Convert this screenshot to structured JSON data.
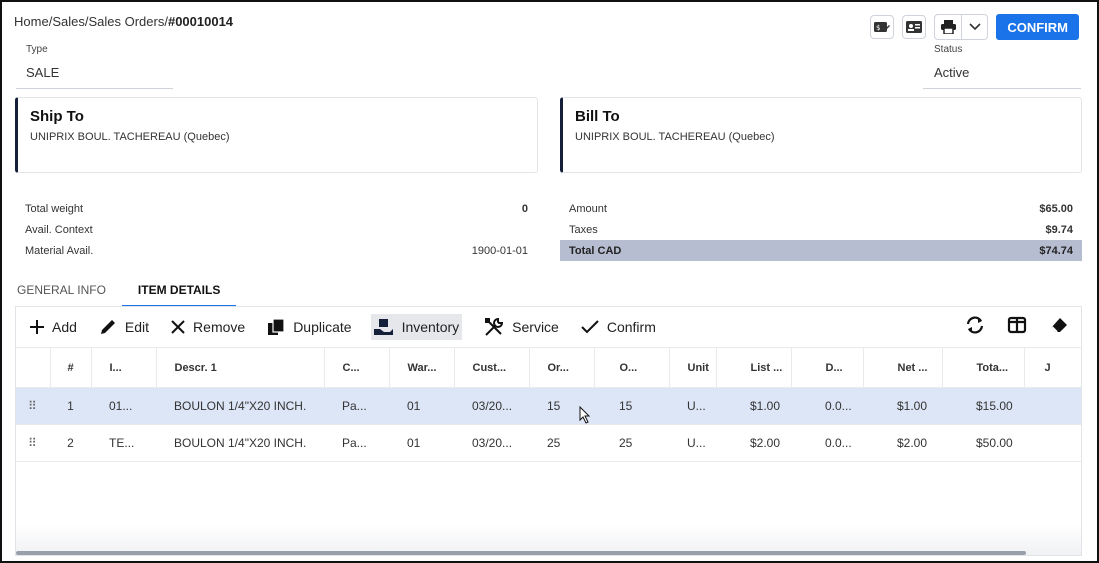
{
  "breadcrumb": {
    "items": [
      "Home",
      "Sales",
      "Sales Orders"
    ],
    "separator": "/",
    "current": "#00010014"
  },
  "header": {
    "confirm_label": "CONFIRM",
    "type_label": "Type",
    "type_value": "SALE",
    "status_label": "Status",
    "status_value": "Active"
  },
  "ship_to": {
    "title": "Ship To",
    "address": "UNIPRIX BOUL. TACHEREAU (Quebec)"
  },
  "bill_to": {
    "title": "Bill To",
    "address": "UNIPRIX BOUL. TACHEREAU (Quebec)"
  },
  "left_summary": [
    {
      "label": "Total weight",
      "value": "0"
    },
    {
      "label": "Avail. Context",
      "value": ""
    },
    {
      "label": "Material Avail.",
      "value": "1900-01-01"
    }
  ],
  "right_summary": [
    {
      "label": "Amount",
      "value": "$65.00"
    },
    {
      "label": "Taxes",
      "value": "$9.74"
    },
    {
      "label": "Total CAD",
      "value": "$74.74"
    }
  ],
  "tabs": [
    {
      "label": "GENERAL INFO",
      "active": false
    },
    {
      "label": "ITEM DETAILS",
      "active": true
    }
  ],
  "toolbar": {
    "add": "Add",
    "edit": "Edit",
    "remove": "Remove",
    "duplicate": "Duplicate",
    "inventory": "Inventory",
    "service": "Service",
    "confirm": "Confirm"
  },
  "grid": {
    "columns": [
      "#",
      "I...",
      "Descr. 1",
      "C...",
      "War...",
      "Cust...",
      "Or...",
      "O...",
      "Unit",
      "List ...",
      "D...",
      "Net ...",
      "Tota...",
      "J"
    ],
    "rows": [
      [
        "1",
        "01...",
        "BOULON 1/4\"X20 INCH.",
        "Pa...",
        "01",
        "03/20...",
        "15",
        "15",
        "U...",
        "$1.00",
        "0.0...",
        "$1.00",
        "$15.00"
      ],
      [
        "2",
        "TE...",
        "BOULON 1/4\"X20 INCH.",
        "Pa...",
        "01",
        "03/20...",
        "25",
        "25",
        "U...",
        "$2.00",
        "0.0...",
        "$2.00",
        "$50.00"
      ]
    ]
  },
  "colors": {
    "accent": "#1a73e8",
    "card_border": "#14203a",
    "total_row": "#b7bdd1",
    "selected_row": "#dde6f6"
  }
}
